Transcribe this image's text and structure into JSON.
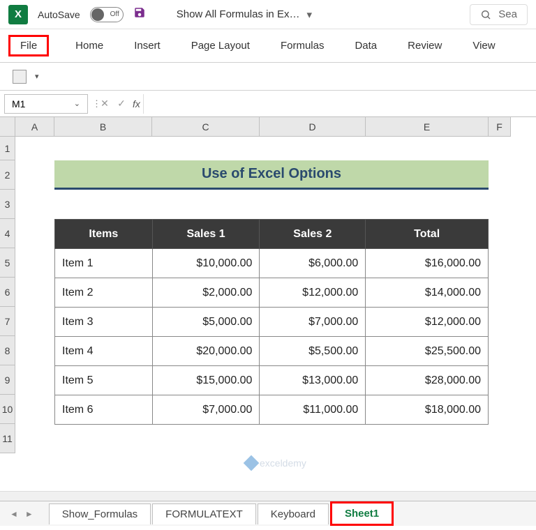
{
  "titlebar": {
    "autosave_label": "AutoSave",
    "autosave_state": "Off",
    "doc_title": "Show All Formulas in Ex…",
    "search_placeholder": "Sea"
  },
  "ribbon": {
    "tabs": [
      "File",
      "Home",
      "Insert",
      "Page Layout",
      "Formulas",
      "Data",
      "Review",
      "View"
    ]
  },
  "formula_bar": {
    "name_box": "M1",
    "fx_label": "fx",
    "formula_value": ""
  },
  "columns": [
    "A",
    "B",
    "C",
    "D",
    "E",
    "F"
  ],
  "rows": [
    "1",
    "2",
    "3",
    "4",
    "5",
    "6",
    "7",
    "8",
    "9",
    "10",
    "11"
  ],
  "sheet_title": "Use of Excel Options",
  "table": {
    "headers": [
      "Items",
      "Sales 1",
      "Sales 2",
      "Total"
    ],
    "rows": [
      [
        "Item 1",
        "$10,000.00",
        "$6,000.00",
        "$16,000.00"
      ],
      [
        "Item 2",
        "$2,000.00",
        "$12,000.00",
        "$14,000.00"
      ],
      [
        "Item 3",
        "$5,000.00",
        "$7,000.00",
        "$12,000.00"
      ],
      [
        "Item 4",
        "$20,000.00",
        "$5,500.00",
        "$25,500.00"
      ],
      [
        "Item 5",
        "$15,000.00",
        "$13,000.00",
        "$28,000.00"
      ],
      [
        "Item 6",
        "$7,000.00",
        "$11,000.00",
        "$18,000.00"
      ]
    ]
  },
  "watermark": "exceldemy",
  "sheet_tabs": [
    "Show_Formulas",
    "FORMULATEXT",
    "Keyboard",
    "Sheet1"
  ],
  "active_tab": "Sheet1"
}
